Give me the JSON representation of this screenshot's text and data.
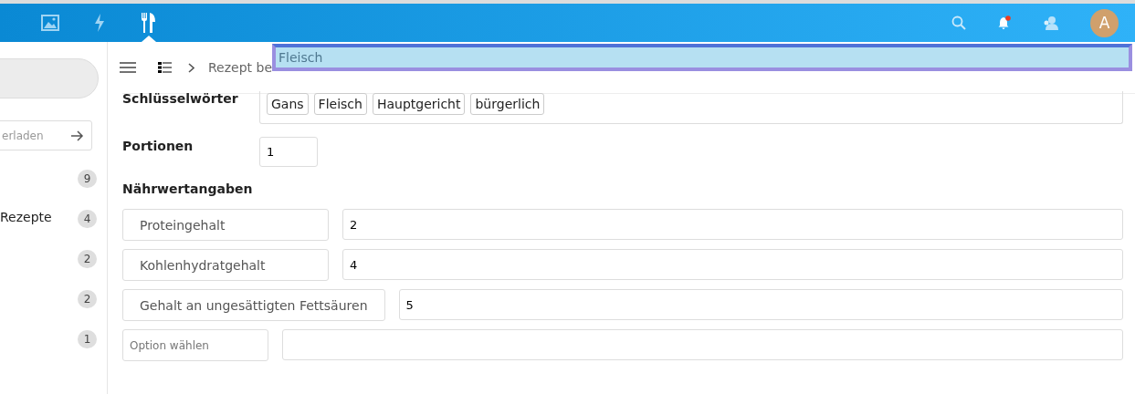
{
  "topbar": {
    "apps": [
      {
        "kind": "image",
        "selected": false
      },
      {
        "kind": "bolt",
        "selected": false
      },
      {
        "kind": "cutlery",
        "selected": true
      }
    ],
    "avatar": "A",
    "notification_dot": true
  },
  "overlay_field": {
    "value": "Fleisch"
  },
  "sidebar": {
    "search_placeholder": "erladen",
    "items": [
      {
        "count": "9"
      },
      {
        "label": "Rezepte",
        "count": "4"
      },
      {
        "count": "2"
      },
      {
        "count": "2"
      },
      {
        "count": "1"
      }
    ]
  },
  "breadcrumb": {
    "text": "Rezept be"
  },
  "keywords": {
    "label": "Schlüsselwörter",
    "tags": [
      "Gans",
      "Fleisch",
      "Hauptgericht",
      "bürgerlich"
    ]
  },
  "portions": {
    "label": "Portionen",
    "value": "1"
  },
  "nutrition": {
    "title": "Nährwertangaben",
    "rows": [
      {
        "label": "Proteingehalt",
        "value": "2",
        "kind": "filled"
      },
      {
        "label": "Kohlenhydratgehalt",
        "value": "4",
        "kind": "filled"
      },
      {
        "label": "Gehalt an ungesättigten Fettsäuren",
        "value": "5",
        "kind": "filled"
      },
      {
        "label": "Option wählen",
        "kind": "select"
      }
    ]
  }
}
